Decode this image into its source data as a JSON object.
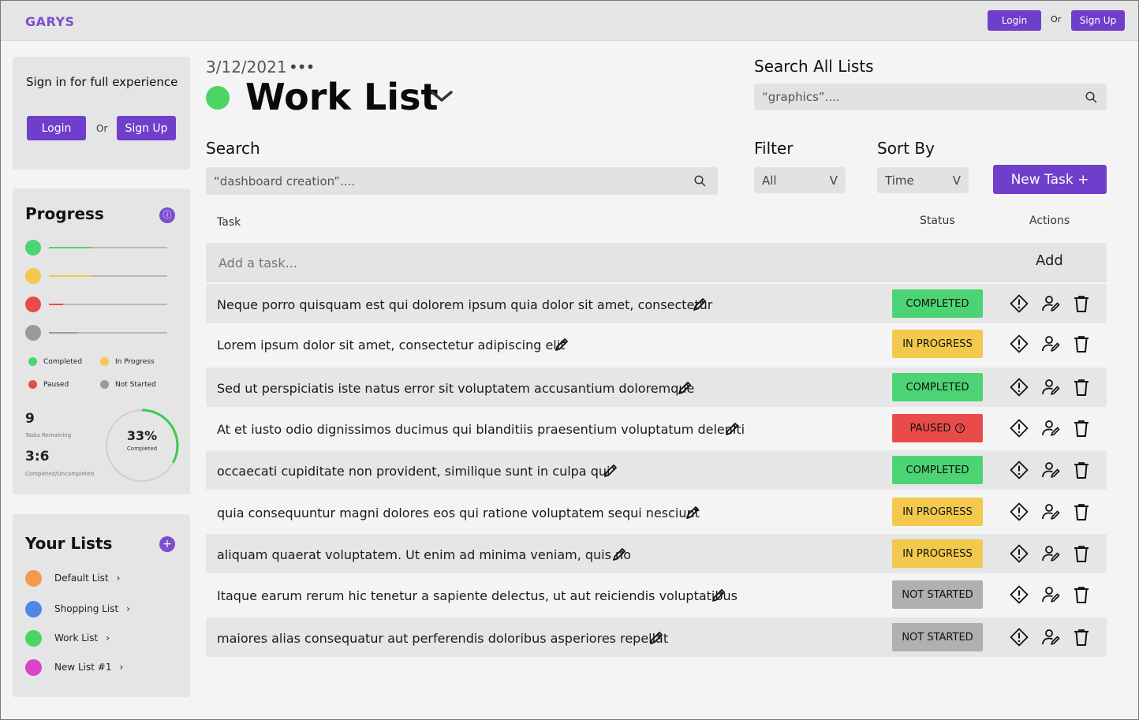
{
  "header": {
    "logo": "GARYS",
    "login_label": "Login",
    "or_label": "Or",
    "signup_label": "Sign Up"
  },
  "signin_panel": {
    "message": "Sign in for full experience",
    "login_label": "Login",
    "or_label": "Or",
    "signup_label": "Sign Up"
  },
  "progress": {
    "title": "Progress",
    "bars": [
      {
        "color": "#4cd474",
        "fill": 0.35
      },
      {
        "color": "#f2c94c",
        "fill": 0.35
      },
      {
        "color": "#e94b4b",
        "fill": 0.12
      },
      {
        "color": "#9a9a9a",
        "fill": 0.24
      }
    ],
    "legend": [
      {
        "label": "Completed",
        "color": "#4cd474"
      },
      {
        "label": "In Progress",
        "color": "#f2c94c"
      },
      {
        "label": "Paused",
        "color": "#e94b4b"
      },
      {
        "label": "Not Started",
        "color": "#9a9a9a"
      }
    ],
    "tasks_remaining": "9",
    "tasks_remaining_label": "Tasks Remaining",
    "ratio": "3:6",
    "ratio_label": "Completed/Uncompleted",
    "percent": "33%",
    "percent_value": 0.33,
    "percent_label": "Completed"
  },
  "lists": {
    "title": "Your Lists",
    "items": [
      {
        "label": "Default List",
        "color": "#f39a4b"
      },
      {
        "label": "Shopping List",
        "color": "#4f86e8"
      },
      {
        "label": "Work List",
        "color": "#4cd464"
      },
      {
        "label": "New List #1",
        "color": "#d944c8"
      }
    ]
  },
  "main": {
    "date": "3/12/2021",
    "more": "•••",
    "title": "Work List",
    "title_color": "#4cd464",
    "search_all_label": "Search All Lists",
    "search_all_value": "“graphics”....",
    "search_label": "Search",
    "search_value": "“dashboard creation”....",
    "filter_label": "Filter",
    "filter_value": "All",
    "sort_label": "Sort By",
    "sort_value": "Time",
    "select_caret": "V",
    "new_task_label": "New Task  +"
  },
  "table": {
    "col_task": "Task",
    "col_status": "Status",
    "col_actions": "Actions",
    "add_placeholder": "Add a task...",
    "add_label": "Add",
    "rows": [
      {
        "text": "Neque porro quisquam est qui dolorem ipsum quia dolor sit amet, consectetur",
        "status": "COMPLETED"
      },
      {
        "text": "Lorem ipsum dolor sit amet, consectetur adipiscing elit",
        "status": "IN PROGRESS"
      },
      {
        "text": "Sed ut perspiciatis iste natus error sit voluptatem accusantium doloremque",
        "status": "COMPLETED"
      },
      {
        "text": "At et iusto odio dignissimos ducimus qui blanditiis praesentium voluptatum deleniti",
        "status": "PAUSED"
      },
      {
        "text": " occaecati cupiditate non provident, similique sunt in culpa qui",
        "status": "COMPLETED"
      },
      {
        "text": "quia consequuntur magni dolores eos qui ratione voluptatem sequi nesciunt",
        "status": "IN PROGRESS"
      },
      {
        "text": "aliquam quaerat voluptatem. Ut enim ad minima veniam, quis no",
        "status": "IN PROGRESS"
      },
      {
        "text": " Itaque earum rerum hic tenetur a sapiente delectus, ut aut reiciendis voluptatibus",
        "status": "NOT STARTED"
      },
      {
        "text": "maiores alias consequatur aut perferendis doloribus asperiores repellat",
        "status": "NOT STARTED"
      }
    ]
  },
  "colors": {
    "accent": "#6f3fcc",
    "completed": "#4cd474",
    "in_progress": "#f2c94c",
    "paused": "#e94b4b",
    "not_started": "#b0b0b0"
  }
}
